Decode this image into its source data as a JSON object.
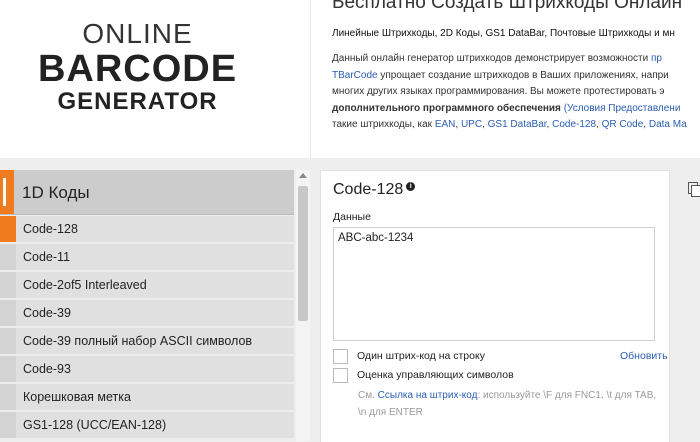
{
  "logo": {
    "line1": "ONLINE",
    "line2": "BARCODE",
    "line3": "GENERATOR"
  },
  "intro": {
    "title": "Бесплатно Создать Штрихкоды Онлайн",
    "subtitle": "Линейные Штрихкоды, 2D Коды, GS1 DataBar, Почтовые Штрихкоды и мн",
    "line1": "Данный онлайн генератор штрихкодов демонстрирует возможности",
    "line1_link": "пр",
    "line2_link": "TBarCode",
    "line2": "упрощает создание штрихкодов в Ваших приложениях, напри",
    "line3": "многих других языках программирования. Вы можете протестировать э",
    "line4_bold": "дополнительного программного обеспечения",
    "line4_link": "(Условия Предоставлени",
    "line5_start": "такие штрихкоды, как",
    "links": [
      "EAN",
      "UPC",
      "GS1 DataBar",
      "Code-128",
      "QR Code",
      "Data Ma"
    ]
  },
  "sidebar": {
    "header": "1D Коды",
    "items": [
      {
        "label": "Code-128",
        "active": true
      },
      {
        "label": "Code-11",
        "active": false
      },
      {
        "label": "Code-2of5 Interleaved",
        "active": false
      },
      {
        "label": "Code-39",
        "active": false
      },
      {
        "label": "Code-39 полный набор ASCII символов",
        "active": false
      },
      {
        "label": "Code-93",
        "active": false
      },
      {
        "label": "Корешковая метка",
        "active": false
      },
      {
        "label": "GS1-128 (UCC/EAN-128)",
        "active": false
      }
    ]
  },
  "panel": {
    "title": "Code-128",
    "info_icon": "i",
    "data_label": "Данные",
    "data_value": "ABC-abc-1234",
    "checkbox1": "Один штрих-код на строку",
    "update": "Обновить",
    "checkbox2": "Оценка управляющих символов",
    "hint_prefix": "См.",
    "hint_link": "Ссылка на штрих-код",
    "hint_rest": ": используйте \\F для FNC1, \\t для TAB, \\n для ENTER"
  },
  "colors": {
    "accent": "#f07a1e",
    "link": "#2a5db0"
  }
}
